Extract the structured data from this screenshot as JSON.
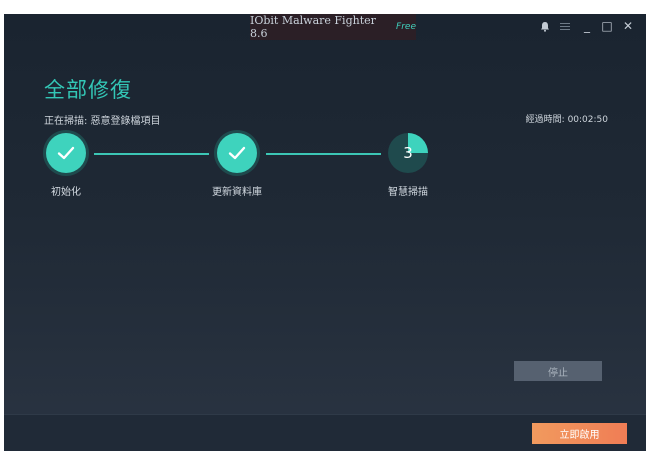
{
  "window": {
    "title": "IObit Malware Fighter 8.6",
    "edition_badge": "Free"
  },
  "controls": {
    "notify_icon": "bell-icon",
    "menu_icon": "menu-icon",
    "minimize": "_",
    "maximize": "□",
    "close": "✕"
  },
  "main": {
    "heading": "全部修復",
    "scan_status": "正在掃描: 惡意登錄檔項目",
    "elapsed": "經過時間: 00:02:50"
  },
  "steps": [
    {
      "label": "初始化",
      "state": "done"
    },
    {
      "label": "更新資料庫",
      "state": "done"
    },
    {
      "label": "智慧掃描",
      "state": "current",
      "number": "3",
      "progress": 0.25
    }
  ],
  "buttons": {
    "stop": "停止",
    "activate": "立即啟用"
  },
  "colors": {
    "accent": "#3ed3bd",
    "activate": "#f08a57"
  }
}
